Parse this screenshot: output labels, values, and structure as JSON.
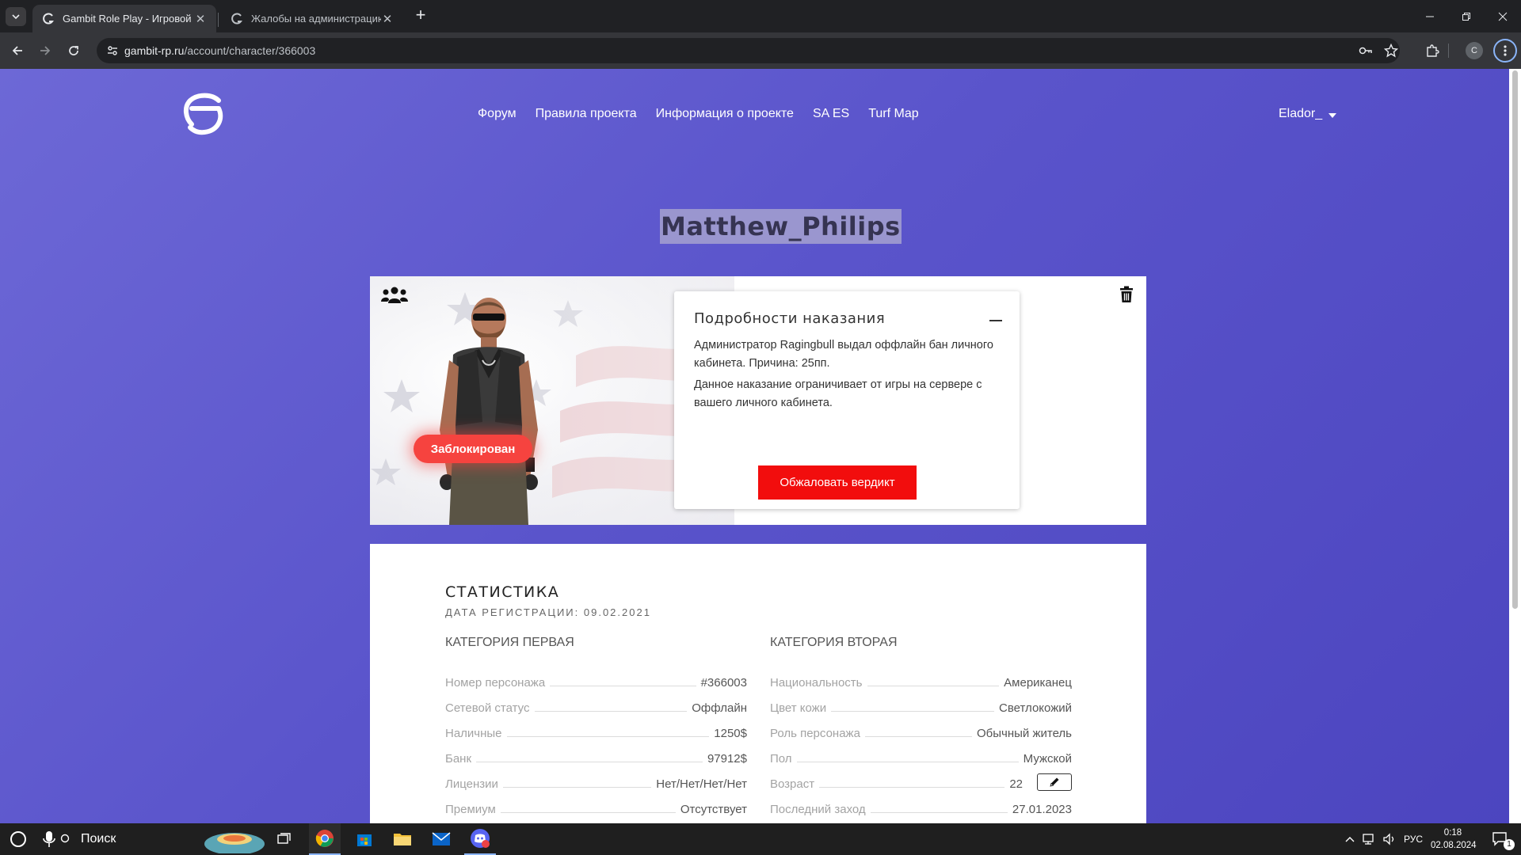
{
  "browser": {
    "tabs": [
      {
        "title": "Gambit Role Play - Игровой пр",
        "active": true
      },
      {
        "title": "Жалобы на администрацию | ",
        "active": false
      }
    ],
    "url_host": "gambit-rp.ru",
    "url_path": "/account/character/366003",
    "profile_letter": "C"
  },
  "site": {
    "nav": [
      "Форум",
      "Правила проекта",
      "Информация о проекте",
      "SA ES",
      "Turf Map"
    ],
    "user": "Elador_"
  },
  "character": {
    "name": "Matthew_Philips",
    "status_badge": "Заблокирован"
  },
  "punishment": {
    "title": "Подробности наказания",
    "text1": "Администратор Ragingbull выдал оффлайн бан личного кабинета. Причина: 25пп.",
    "text2": "Данное наказание ограничивает от игры на сервере с вашего личного кабинета.",
    "appeal_label": "Обжаловать вердикт"
  },
  "stats": {
    "title": "СТАТИСТИКА",
    "registration": "ДАТА РЕГИСТРАЦИИ: 09.02.2021",
    "cat1": {
      "title": "КАТЕГОРИЯ ПЕРВАЯ",
      "rows": [
        {
          "label": "Номер персонажа",
          "value": "#366003"
        },
        {
          "label": "Сетевой статус",
          "value": "Оффлайн"
        },
        {
          "label": "Наличные",
          "value": "1250$"
        },
        {
          "label": "Банк",
          "value": "97912$"
        },
        {
          "label": "Лицензии",
          "value": "Нет/Нет/Нет/Нет"
        },
        {
          "label": "Премиум",
          "value": "Отсутствует"
        }
      ]
    },
    "cat2": {
      "title": "КАТЕГОРИЯ ВТОРАЯ",
      "rows": [
        {
          "label": "Национальность",
          "value": "Американец"
        },
        {
          "label": "Цвет кожи",
          "value": "Светлокожий"
        },
        {
          "label": "Роль персонажа",
          "value": "Обычный житель"
        },
        {
          "label": "Пол",
          "value": "Мужской"
        },
        {
          "label": "Возраст",
          "value": "22"
        },
        {
          "label": "Последний заход",
          "value": "27.01.2023"
        }
      ]
    }
  },
  "taskbar": {
    "search_placeholder": "Поиск",
    "lang": "РУС",
    "time": "0:18",
    "date": "02.08.2024",
    "notification_count": "1"
  },
  "colors": {
    "page_gradient_start": "#6d68d6",
    "page_gradient_end": "#4c45bf",
    "blocked_badge": "#f6433f",
    "appeal_button": "#f20d0d"
  }
}
